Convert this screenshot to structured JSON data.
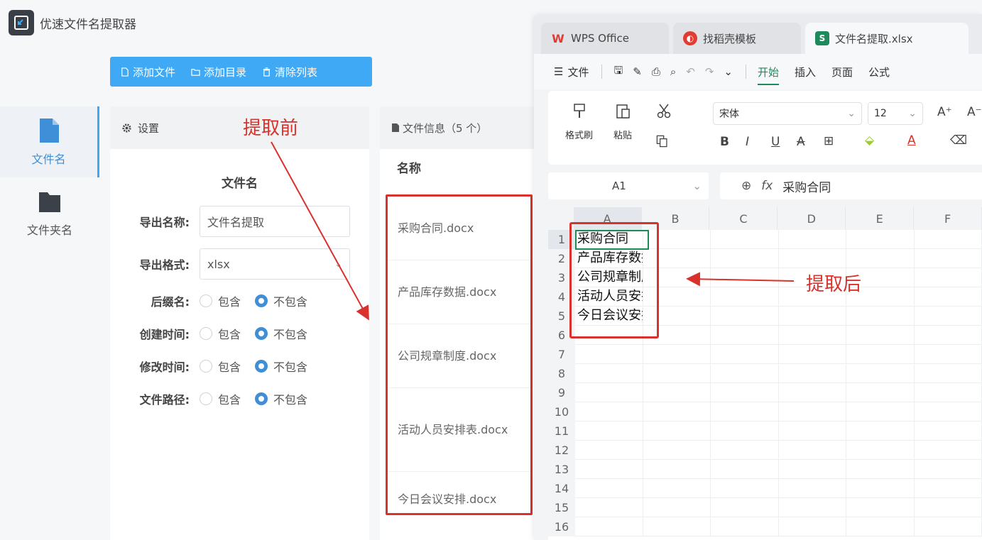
{
  "app": {
    "title": "优速文件名提取器",
    "toolbar": {
      "add_file": "添加文件",
      "add_dir": "添加目录",
      "clear_list": "清除列表"
    },
    "nav": [
      {
        "label": "文件名",
        "active": true
      },
      {
        "label": "文件夹名",
        "active": false
      }
    ],
    "settings": {
      "header": "设置",
      "section_title": "文件名",
      "export_name_label": "导出名称:",
      "export_name_value": "文件名提取",
      "export_format_label": "导出格式:",
      "export_format_value": "xlsx",
      "options": [
        {
          "label": "后缀名:",
          "include": "包含",
          "exclude": "不包含",
          "selected": "不包含"
        },
        {
          "label": "创建时间:",
          "include": "包含",
          "exclude": "不包含",
          "selected": "不包含"
        },
        {
          "label": "修改时间:",
          "include": "包含",
          "exclude": "不包含",
          "selected": "不包含"
        },
        {
          "label": "文件路径:",
          "include": "包含",
          "exclude": "不包含",
          "selected": "不包含"
        }
      ]
    },
    "file_panel": {
      "header": "文件信息（5 个）",
      "column": "名称",
      "files": [
        "采购合同.docx",
        "产品库存数据.docx",
        "公司规章制度.docx",
        "活动人员安排表.docx",
        "今日会议安排.docx"
      ]
    }
  },
  "annotations": {
    "before": "提取前",
    "after": "提取后"
  },
  "wps": {
    "tabs": [
      {
        "label": "WPS Office",
        "icon_color": "#e23b32",
        "icon_name": "wps-logo-icon"
      },
      {
        "label": "找稻壳模板",
        "icon_color": "#e23b32",
        "icon_name": "docer-icon"
      },
      {
        "label": "文件名提取.xlsx",
        "icon_color": "#1d8a5b",
        "icon_name": "spreadsheet-icon",
        "active": true
      }
    ],
    "menu": {
      "file": "文件",
      "tabs": [
        "开始",
        "插入",
        "页面",
        "公式"
      ],
      "active_tab": "开始"
    },
    "ribbon": {
      "format_painter": "格式刷",
      "paste": "粘贴",
      "font_name": "宋体",
      "font_size": "12"
    },
    "formula_bar": {
      "cell_ref": "A1",
      "fx": "fx",
      "content": "采购合同"
    },
    "columns": [
      "A",
      "B",
      "C",
      "D",
      "E",
      "F"
    ],
    "rows": [
      "1",
      "2",
      "3",
      "4",
      "5",
      "6",
      "7",
      "8",
      "9",
      "10",
      "11",
      "12",
      "13",
      "14",
      "15",
      "16"
    ],
    "cells_col_a": [
      "采购合同",
      "产品库存数据",
      "公司规章制度",
      "活动人员安排表",
      "今日会议安排"
    ],
    "accent_color": "#1d8a5b",
    "annotation_color": "#d9312b"
  }
}
